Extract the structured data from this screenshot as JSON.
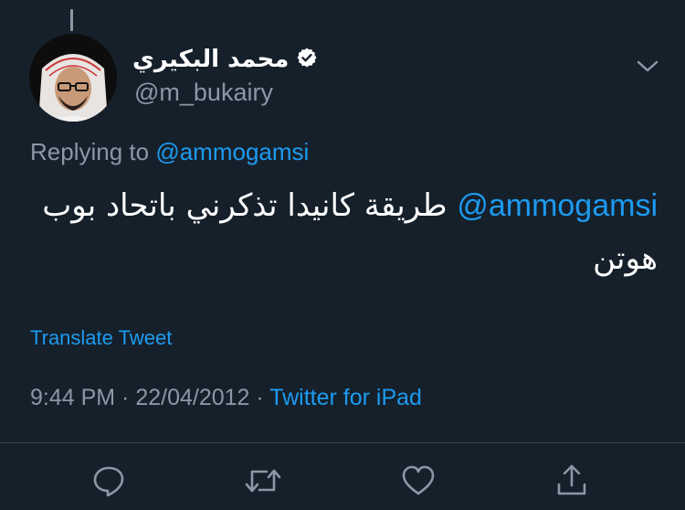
{
  "author": {
    "display_name": "محمد البكيري",
    "handle": "@m_bukairy",
    "verified": true
  },
  "reply_context": {
    "prefix": "Replying to",
    "mention": "@ammogamsi"
  },
  "tweet": {
    "mention": "@ammogamsi",
    "text": " طريقة كانيدا تذكرني باتحاد بوب هوتن"
  },
  "translate_label": "Translate Tweet",
  "meta": {
    "time": "9:44 PM",
    "separator": " · ",
    "date": "22/04/2012",
    "source": "Twitter for iPad"
  },
  "icons": {
    "caret": "chevron-down-icon",
    "verified": "verified-badge-icon",
    "reply": "reply-icon",
    "retweet": "retweet-icon",
    "like": "heart-icon",
    "share": "share-icon"
  },
  "colors": {
    "background": "#15202b",
    "accent": "#1d9bf0",
    "secondary_text": "#8b98a5",
    "primary_text": "#ffffff"
  }
}
